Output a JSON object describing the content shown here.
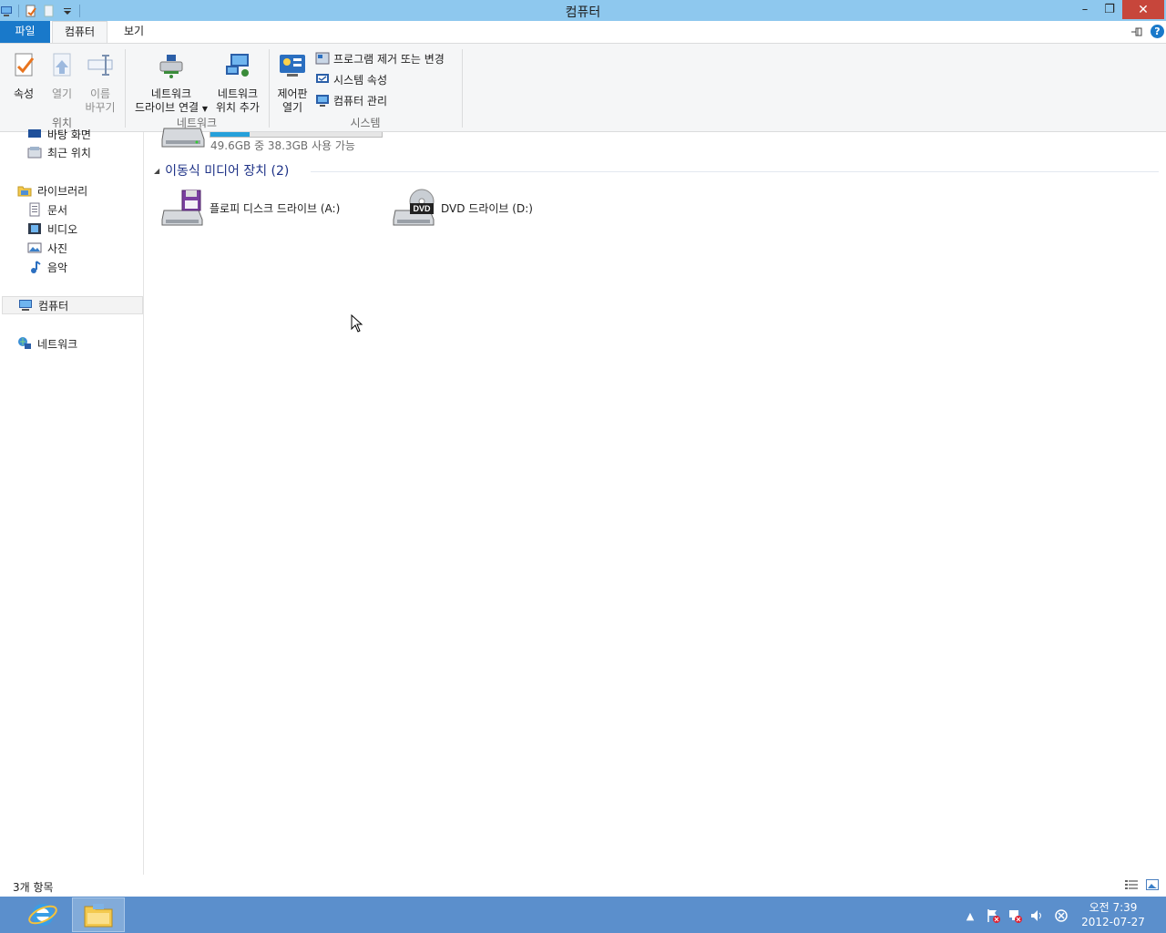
{
  "window": {
    "title": "컴퓨터",
    "buttons": {
      "minimize": "–",
      "maximize": "❐",
      "close": "✕"
    }
  },
  "ribbon": {
    "tabs": [
      {
        "label": "파일"
      },
      {
        "label": "컴퓨터"
      },
      {
        "label": "보기"
      }
    ],
    "groups": {
      "location": {
        "label": "위치",
        "properties": "속성",
        "open": "열기",
        "rename_line1": "이름",
        "rename_line2": "바꾸기"
      },
      "network": {
        "label": "네트워크",
        "map_drive_line1": "네트워크",
        "map_drive_line2": "드라이브 연결",
        "add_location_line1": "네트워크",
        "add_location_line2": "위치 추가"
      },
      "system": {
        "label": "시스템",
        "control_panel_line1": "제어판",
        "control_panel_line2": "열기",
        "uninstall": "프로그램 제거 또는 변경",
        "system_properties": "시스템 속성",
        "manage": "컴퓨터 관리"
      }
    },
    "help": "?"
  },
  "nav": {
    "desktop": "바탕 화면",
    "recent": "최근 위치",
    "libraries": "라이브러리",
    "documents": "문서",
    "videos": "비디오",
    "pictures": "사진",
    "music": "음악",
    "computer": "컴퓨터",
    "network": "네트워크"
  },
  "content": {
    "drive_c": {
      "free_text": "49.6GB 중 38.3GB 사용 가능",
      "used_fraction": 0.23
    },
    "group_removable": "이동식 미디어 장치 (2)",
    "devices": [
      {
        "label": "플로피 디스크 드라이브 (A:)",
        "icon": "floppy-drive-icon"
      },
      {
        "label": "DVD 드라이브 (D:)",
        "icon": "dvd-drive-icon",
        "badge": "DVD"
      }
    ]
  },
  "status": {
    "item_count": "3개 항목"
  },
  "taskbar": {
    "clock_time": "오전 7:39",
    "clock_date": "2012-07-27",
    "tray_arrow": "▲"
  },
  "colors": {
    "titlebar": "#8ec8ee",
    "file_tab": "#1979ca",
    "taskbar": "#5b8fcc",
    "close": "#c7463b",
    "group_header": "#1e3287",
    "capacity_bar": "#26a0da"
  }
}
